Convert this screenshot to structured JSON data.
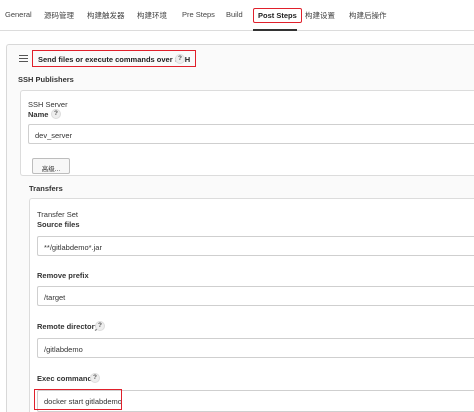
{
  "tabs": [
    {
      "label": "General"
    },
    {
      "label": "源码管理"
    },
    {
      "label": "构建触发器"
    },
    {
      "label": "构建环境"
    },
    {
      "label": "Pre Steps"
    },
    {
      "label": "Build"
    },
    {
      "label": "Post Steps",
      "active": true
    },
    {
      "label": "构建设置"
    },
    {
      "label": "构建后操作"
    }
  ],
  "step": {
    "title": "Send files or execute commands over SSH",
    "help": "?"
  },
  "publishers": {
    "heading": "SSH Publishers",
    "server": {
      "heading": "SSH Server",
      "name_label": "Name",
      "name_value": "dev_server",
      "advanced_button": "高级..."
    },
    "transfers": {
      "heading": "Transfers",
      "set_heading": "Transfer Set",
      "source_files_label": "Source files",
      "source_files_value": "**/gitlabdemo*.jar",
      "remove_prefix_label": "Remove prefix",
      "remove_prefix_value": "/target",
      "remote_directory_label": "Remote directory",
      "remote_directory_value": "/gitlabdemo",
      "exec_command_label": "Exec command",
      "exec_command_value": "docker start gitlabdemo"
    }
  },
  "colors": {
    "highlight": "#e0202b",
    "border": "#dcdcdc"
  }
}
